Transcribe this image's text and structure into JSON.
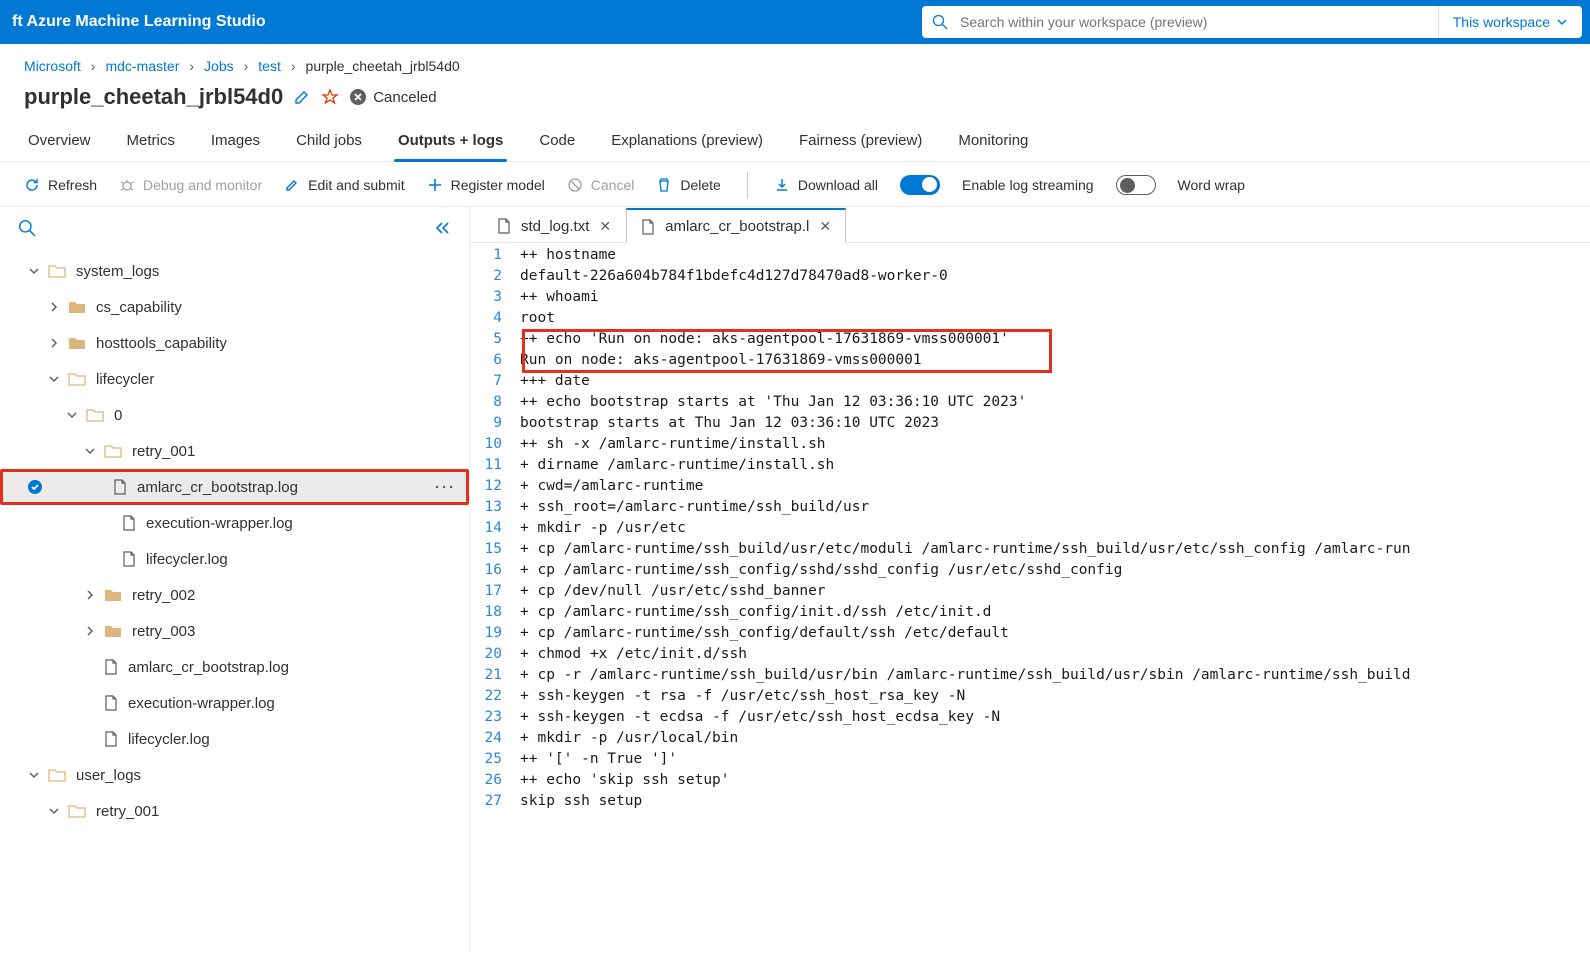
{
  "topbar": {
    "product": "ft Azure Machine Learning Studio",
    "search_placeholder": "Search within your workspace (preview)",
    "scope_label": "This workspace"
  },
  "breadcrumbs": [
    "Microsoft",
    "mdc-master",
    "Jobs",
    "test",
    "purple_cheetah_jrbl54d0"
  ],
  "job": {
    "name": "purple_cheetah_jrbl54d0",
    "status": "Canceled"
  },
  "tabs": [
    {
      "label": "Overview",
      "active": false
    },
    {
      "label": "Metrics",
      "active": false
    },
    {
      "label": "Images",
      "active": false
    },
    {
      "label": "Child jobs",
      "active": false
    },
    {
      "label": "Outputs + logs",
      "active": true
    },
    {
      "label": "Code",
      "active": false
    },
    {
      "label": "Explanations (preview)",
      "active": false
    },
    {
      "label": "Fairness (preview)",
      "active": false
    },
    {
      "label": "Monitoring",
      "active": false
    }
  ],
  "toolbar": {
    "refresh": "Refresh",
    "debug": "Debug and monitor",
    "edit": "Edit and submit",
    "register": "Register model",
    "cancel": "Cancel",
    "delete": "Delete",
    "download": "Download all",
    "log_stream": "Enable log streaming",
    "word_wrap": "Word wrap",
    "log_stream_on": true,
    "word_wrap_on": false
  },
  "tree": {
    "system_logs": "system_logs",
    "cs_capability": "cs_capability",
    "hosttools": "hosttools_capability",
    "lifecycler": "lifecycler",
    "zero": "0",
    "retry_001": "retry_001",
    "amlarc": "amlarc_cr_bootstrap.log",
    "exec_wrap": "execution-wrapper.log",
    "lifecycler_log": "lifecycler.log",
    "retry_002": "retry_002",
    "retry_003": "retry_003",
    "amlarc2": "amlarc_cr_bootstrap.log",
    "exec_wrap2": "execution-wrapper.log",
    "lifecycler_log2": "lifecycler.log",
    "user_logs": "user_logs",
    "retry_001b": "retry_001"
  },
  "file_tabs": [
    {
      "name": "std_log.txt",
      "active": false
    },
    {
      "name": "amlarc_cr_bootstrap.l",
      "active": true
    }
  ],
  "log_lines": [
    "++ hostname",
    "default-226a604b784f1bdefc4d127d78470ad8-worker-0",
    "++ whoami",
    "root",
    "++ echo 'Run on node: aks-agentpool-17631869-vmss000001'",
    "Run on node: aks-agentpool-17631869-vmss000001",
    "+++ date",
    "++ echo bootstrap starts at 'Thu Jan 12 03:36:10 UTC 2023'",
    "bootstrap starts at Thu Jan 12 03:36:10 UTC 2023",
    "++ sh -x /amlarc-runtime/install.sh",
    "+ dirname /amlarc-runtime/install.sh",
    "+ cwd=/amlarc-runtime",
    "+ ssh_root=/amlarc-runtime/ssh_build/usr",
    "+ mkdir -p /usr/etc",
    "+ cp /amlarc-runtime/ssh_build/usr/etc/moduli /amlarc-runtime/ssh_build/usr/etc/ssh_config /amlarc-run",
    "+ cp /amlarc-runtime/ssh_config/sshd/sshd_config /usr/etc/sshd_config",
    "+ cp /dev/null /usr/etc/sshd_banner",
    "+ cp /amlarc-runtime/ssh_config/init.d/ssh /etc/init.d",
    "+ cp /amlarc-runtime/ssh_config/default/ssh /etc/default",
    "+ chmod +x /etc/init.d/ssh",
    "+ cp -r /amlarc-runtime/ssh_build/usr/bin /amlarc-runtime/ssh_build/usr/sbin /amlarc-runtime/ssh_build",
    "+ ssh-keygen -t rsa -f /usr/etc/ssh_host_rsa_key -N",
    "+ ssh-keygen -t ecdsa -f /usr/etc/ssh_host_ecdsa_key -N",
    "+ mkdir -p /usr/local/bin",
    "++ '[' -n True ']'",
    "++ echo 'skip ssh setup'",
    "skip ssh setup"
  ]
}
